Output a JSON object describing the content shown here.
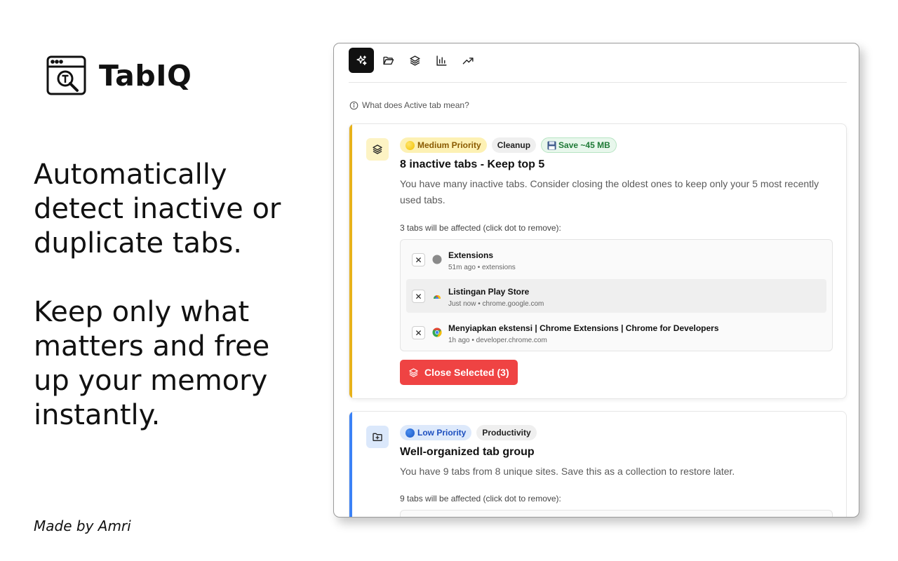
{
  "brand": {
    "name": "TabIQ",
    "logo_icon": "browser-search-icon"
  },
  "promo": {
    "line1": "Automatically detect inactive or duplicate tabs.",
    "line2": "Keep only what matters and free up your memory instantly.",
    "credit": "Made by Amri"
  },
  "toolbar": {
    "buttons": [
      {
        "icon": "sparkles-icon",
        "active": true
      },
      {
        "icon": "folder-icon",
        "active": false
      },
      {
        "icon": "layers-icon",
        "active": false
      },
      {
        "icon": "bar-chart-icon",
        "active": false
      },
      {
        "icon": "trending-up-icon",
        "active": false
      }
    ]
  },
  "help": {
    "label": "What does Active tab mean?"
  },
  "cards": [
    {
      "accent": "#e8b21b",
      "icon": "layers-icon",
      "badges": {
        "priority": "Medium Priority",
        "category": "Cleanup",
        "save": "Save ~45 MB"
      },
      "title": "8 inactive tabs - Keep top 5",
      "description": "You have many inactive tabs. Consider closing the oldest ones to keep only your 5 most recently used tabs.",
      "affected": "3 tabs will be affected (click dot to remove):",
      "tabs": [
        {
          "name": "Extensions",
          "meta": "51m ago • extensions",
          "favicon": "gray-dot-icon"
        },
        {
          "name": "Listingan Play Store",
          "meta": "Just now • chrome.google.com",
          "favicon": "chrome-web-store-icon"
        },
        {
          "name": "Menyiapkan ekstensi  |  Chrome Extensions  |  Chrome for Developers",
          "meta": "1h ago • developer.chrome.com",
          "favicon": "chrome-icon"
        }
      ],
      "action": "Close Selected (3)"
    },
    {
      "accent": "#3b82f6",
      "icon": "folder-plus-icon",
      "badges": {
        "priority": "Low Priority",
        "category": "Productivity"
      },
      "title": "Well-organized tab group",
      "description": "You have 9 tabs from 8 unique sites. Save this as a collection to restore later.",
      "affected": "9 tabs will be affected (click dot to remove):"
    }
  ]
}
